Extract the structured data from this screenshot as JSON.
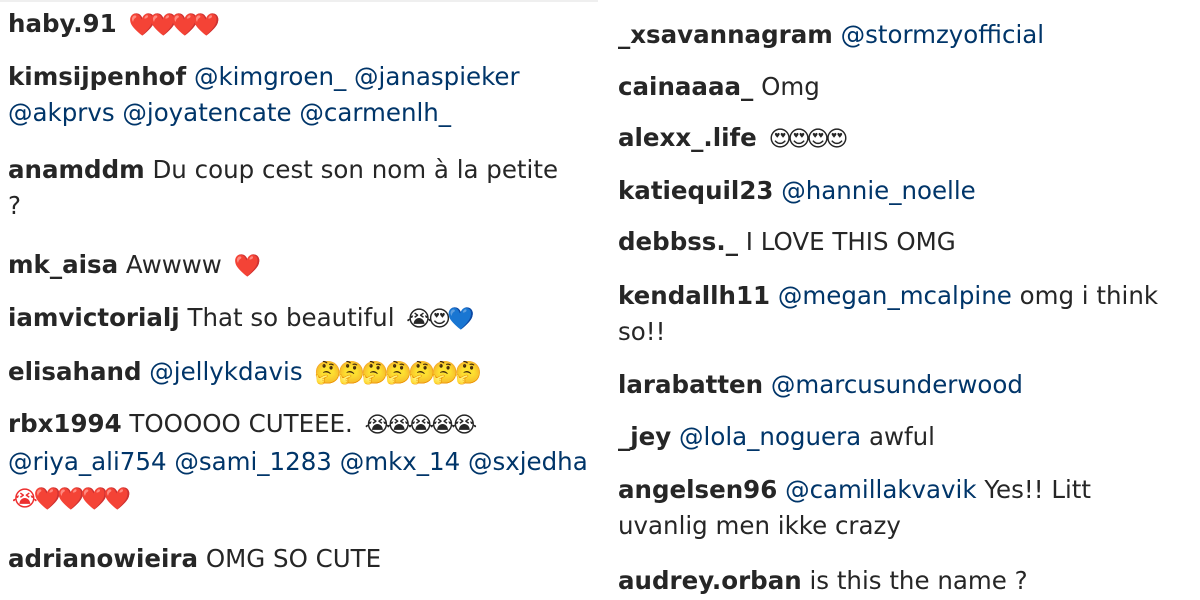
{
  "left": {
    "comments": [
      {
        "user": "haby.91",
        "emoji": "❤️❤️❤️❤️"
      },
      {
        "user": "kimsijpenhof",
        "m1": "@kimgroen_",
        "m2": "@janaspieker",
        "m3": "@akprvs",
        "m4": "@joyatencate",
        "m5": "@carmenlh_"
      },
      {
        "user": "anamddm",
        "text": "Du coup cest son nom à la petite ?"
      },
      {
        "user": "mk_aisa",
        "text": "Awwww",
        "emoji": "❤️"
      },
      {
        "user": "iamvictorialj",
        "text": "That so beautiful",
        "emoji": "😭😍💙"
      },
      {
        "user": "elisahand",
        "m1": "@jellykdavis",
        "emoji": "🤔🤔🤔🤔🤔🤔🤔"
      },
      {
        "user": "rbx1994",
        "text": "TOOOOO CUTEEE.",
        "emoji": "😭😭😭😭😭",
        "m1": "@riya_ali754",
        "m2": "@sami_1283",
        "m3": "@mkx_14",
        "m4": "@sxjedha",
        "emoji2": "😭❤️❤️❤️❤️"
      },
      {
        "user": "adrianowieira",
        "text": "OMG SO CUTE"
      }
    ]
  },
  "right": {
    "comments": [
      {
        "user": "_xsavannagram",
        "m1": "@stormzyofficial"
      },
      {
        "user": "cainaaaa_",
        "text": "Omg"
      },
      {
        "user": "alexx_.life",
        "emoji": "😍😍😍😍"
      },
      {
        "user": "katiequil23",
        "m1": "@hannie_noelle"
      },
      {
        "user": "debbss._",
        "text": "I LOVE THIS OMG"
      },
      {
        "user": "kendallh11",
        "m1": "@megan_mcalpine",
        "text": "omg i think so!!"
      },
      {
        "user": "larabatten",
        "m1": "@marcusunderwood"
      },
      {
        "user": "_jey",
        "m1": "@lola_noguera",
        "text": "awful"
      },
      {
        "user": "angelsen96",
        "m1": "@camillakvavik",
        "text": "Yes!! Litt uvanlig men ikke crazy"
      },
      {
        "user": "audrey.orban",
        "text": "is this the name ?"
      }
    ]
  }
}
